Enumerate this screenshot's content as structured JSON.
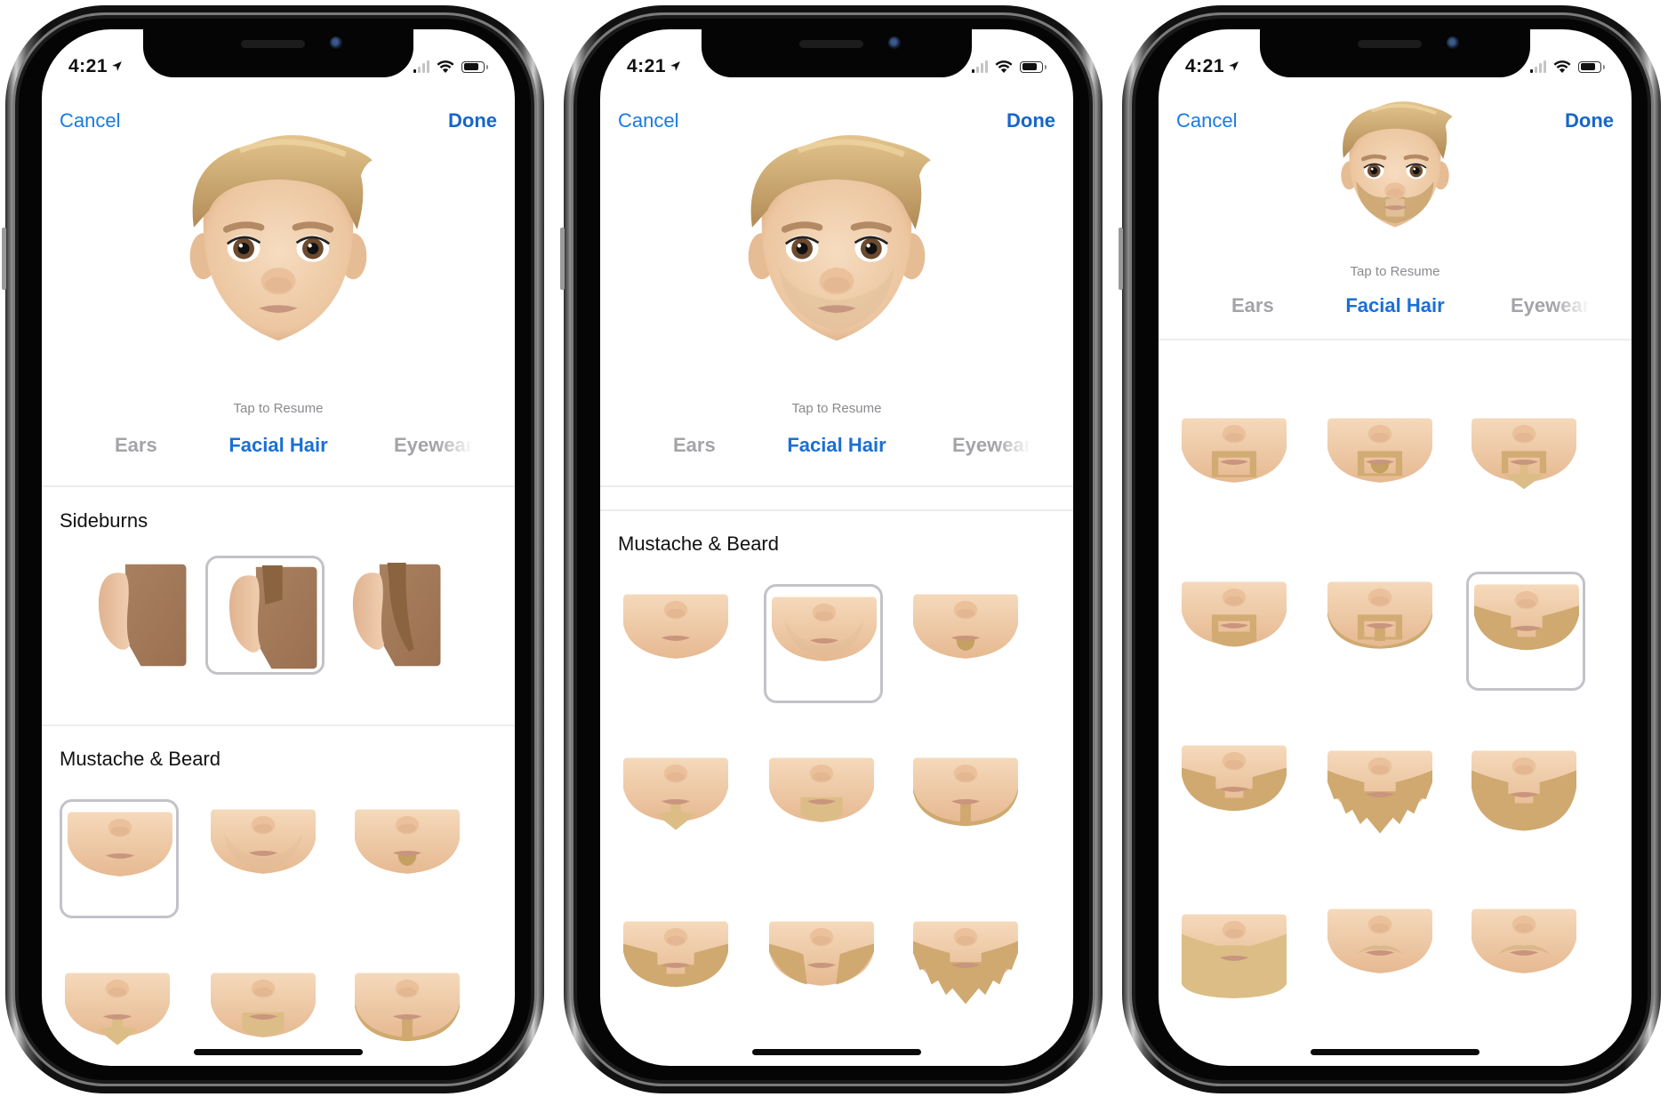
{
  "phones": [
    {
      "status": {
        "time": "4:21",
        "location_icon": "location-arrow-icon",
        "signal_bars": 4,
        "signal_active": 1,
        "battery_level": 0.8
      },
      "nav": {
        "cancel": "Cancel",
        "done": "Done"
      },
      "avatar": {
        "beard": "none",
        "size": "large"
      },
      "tap_to_resume": "Tap to Resume",
      "tabs": [
        {
          "label": "Ears",
          "active": false
        },
        {
          "label": "Facial Hair",
          "active": true
        },
        {
          "label": "Eyewear",
          "active": false
        }
      ],
      "sections": [
        {
          "title": "Sideburns",
          "options": [
            "none",
            "short",
            "long"
          ],
          "selected": 1
        },
        {
          "title": "Mustache & Beard",
          "options": [
            "none",
            "stubble",
            "soul-patch",
            "chin-strip-pointed",
            "chin-beard",
            "chinstrap-strip"
          ],
          "selected": 0
        }
      ]
    },
    {
      "status": {
        "time": "4:21",
        "location_icon": "location-arrow-icon",
        "signal_bars": 4,
        "signal_active": 1,
        "battery_level": 0.8
      },
      "nav": {
        "cancel": "Cancel",
        "done": "Done"
      },
      "avatar": {
        "beard": "stubble",
        "size": "large"
      },
      "tap_to_resume": "Tap to Resume",
      "tabs": [
        {
          "label": "Ears",
          "active": false
        },
        {
          "label": "Facial Hair",
          "active": true
        },
        {
          "label": "Eyewear",
          "active": false
        }
      ],
      "sections": [
        {
          "title": "Mustache & Beard",
          "options": [
            "none",
            "stubble",
            "soul-patch",
            "chin-strip-pointed",
            "chin-beard",
            "chinstrap-strip",
            "beard-gap",
            "mutton-chops",
            "full-spiky"
          ],
          "selected": 1
        }
      ]
    },
    {
      "status": {
        "time": "4:21",
        "location_icon": "location-arrow-icon",
        "signal_bars": 4,
        "signal_active": 1,
        "battery_level": 0.8
      },
      "nav": {
        "cancel": "Cancel",
        "done": "Done"
      },
      "avatar": {
        "beard": "short-beard",
        "size": "small"
      },
      "tap_to_resume": "Tap to Resume",
      "tabs": [
        {
          "label": "Ears",
          "active": false
        },
        {
          "label": "Facial Hair",
          "active": true
        },
        {
          "label": "Eyewear",
          "active": false
        }
      ],
      "sections": [
        {
          "title": "",
          "options": [
            "goatee-square",
            "goatee-soul",
            "goatee-pointed",
            "goatee-full",
            "goatee-chinstrap",
            "short-beard",
            "mutton-gap",
            "full-spiky",
            "full-beard",
            "long-square",
            "mustache-thin",
            "mustache-wide"
          ],
          "selected": 5
        }
      ]
    }
  ],
  "colors": {
    "accent": "#1a7ae0",
    "tab_inactive": "#a4a4a8",
    "skin": "#f0cfae",
    "hair": "#c9a56e",
    "sideburn_skin": "#a97e5c",
    "selection_border": "#c2c3c8"
  }
}
